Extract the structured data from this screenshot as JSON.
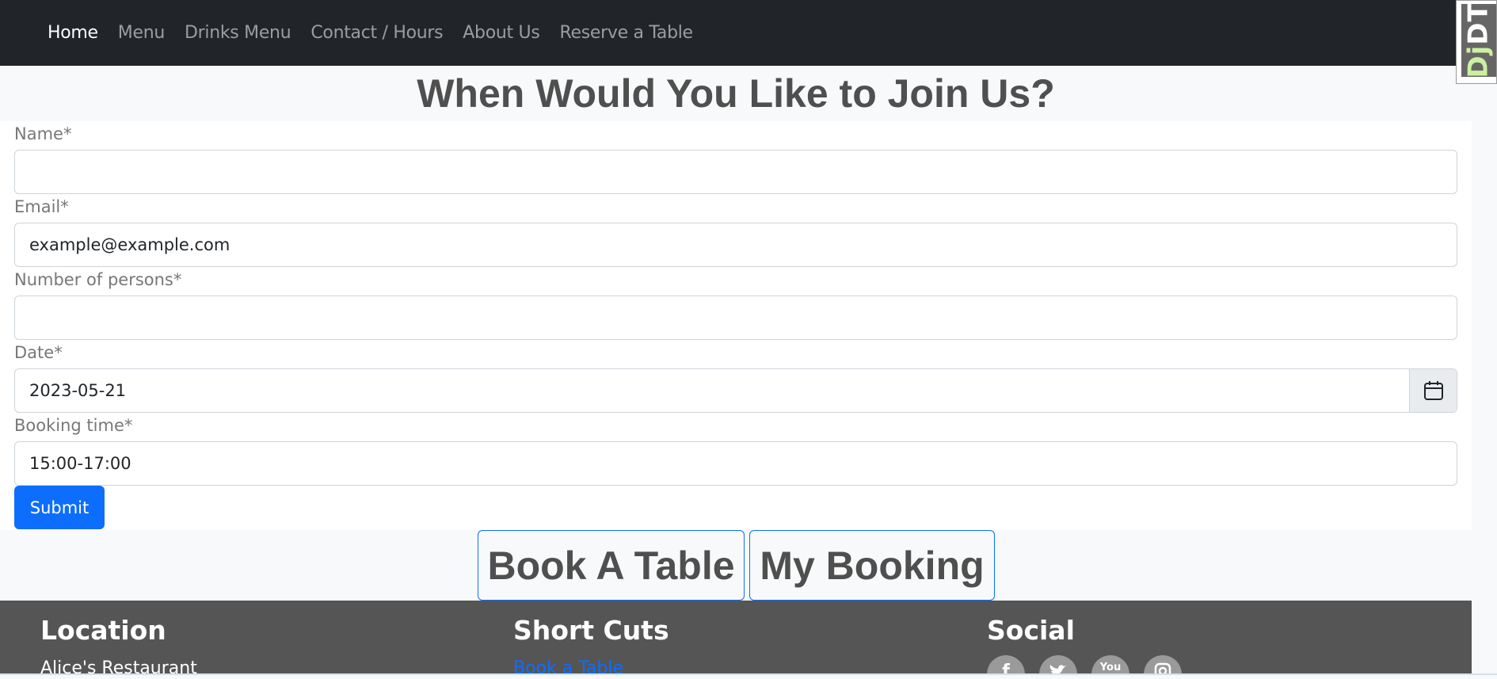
{
  "nav": {
    "items": [
      {
        "label": "Home",
        "active": true
      },
      {
        "label": "Menu"
      },
      {
        "label": "Drinks Menu"
      },
      {
        "label": "Contact / Hours"
      },
      {
        "label": "About Us"
      },
      {
        "label": "Reserve a Table"
      }
    ],
    "toolbar_badge": "DjDT"
  },
  "page": {
    "heading": "When Would You Like to Join Us?"
  },
  "form": {
    "name": {
      "label": "Name*",
      "value": ""
    },
    "email": {
      "label": "Email*",
      "value": "example@example.com"
    },
    "persons": {
      "label": "Number of persons*",
      "value": ""
    },
    "date": {
      "label": "Date*",
      "value": "2023-05-21"
    },
    "time": {
      "label": "Booking time*",
      "value": "15:00-17:00"
    },
    "submit_label": "Submit"
  },
  "actions": {
    "book": "Book A Table",
    "my_booking": "My Booking"
  },
  "footer": {
    "location_title": "Location",
    "location_text": "Alice's Restaurant",
    "shortcuts_title": "Short Cuts",
    "shortcut_link": "Book a Table",
    "social_title": "Social",
    "social_icons": [
      "facebook-icon",
      "twitter-icon",
      "youtube-icon",
      "instagram-icon"
    ]
  },
  "colors": {
    "navbar": "#212529",
    "primary": "#0d6efd",
    "footer": "#555555"
  }
}
